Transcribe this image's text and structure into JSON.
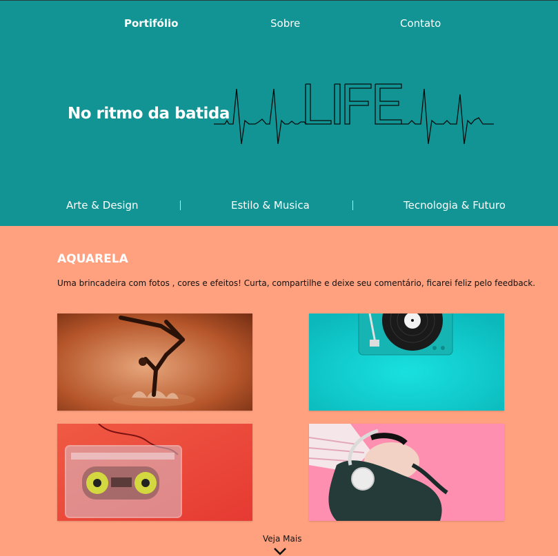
{
  "topnav": [
    {
      "label": "Portifólio",
      "active": true
    },
    {
      "label": "Sobre",
      "active": false
    },
    {
      "label": "Contato",
      "active": false
    }
  ],
  "hero": {
    "title": "No ritmo da batida",
    "graphic_text": "LIFE"
  },
  "categories": [
    "Arte & Design",
    "Estilo & Musica",
    "Tecnologia & Futuro"
  ],
  "section": {
    "title": "AQUARELA",
    "description": "Uma brincadeira com fotos , cores e efeitos! Curta, compartilhe e deixe seu comentário, ficarei feliz pelo feedback."
  },
  "more": {
    "label": "Veja Mais",
    "icon": "chevron-down-icon"
  },
  "colors": {
    "header_bg": "#129494",
    "body_bg": "#ffa07f",
    "turquoise": "#14cfd0",
    "pink": "#ff8fb0",
    "red": "#f04a38"
  }
}
